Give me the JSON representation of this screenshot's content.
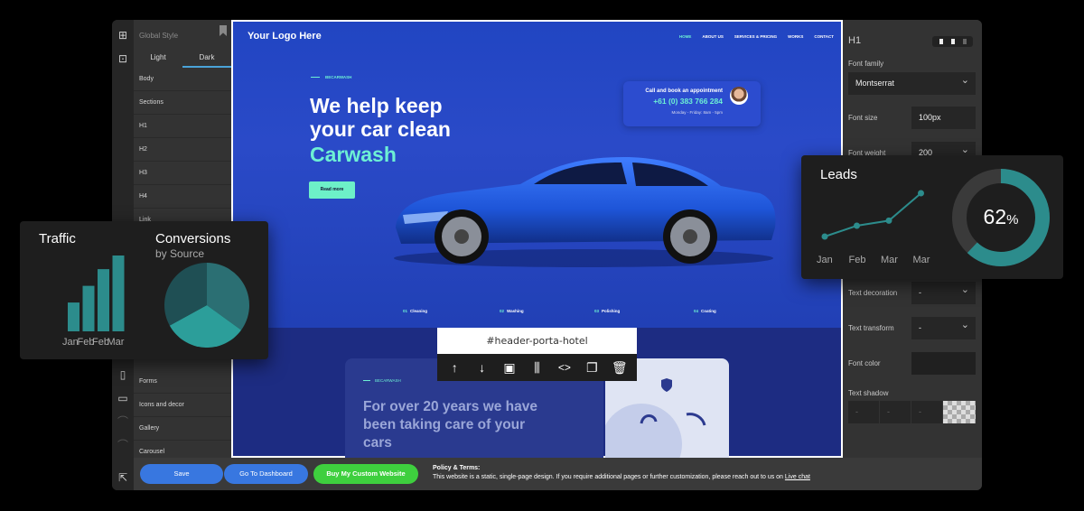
{
  "left_panel": {
    "title": "Global Style",
    "tabs": [
      "Light",
      "Dark"
    ],
    "items": [
      "Body",
      "Sections",
      "H1",
      "H2",
      "H3",
      "H4",
      "Link"
    ],
    "items_lower": [
      "Forms",
      "Icons and decor",
      "Gallery",
      "Carousel"
    ]
  },
  "site": {
    "logo": "Your Logo Here",
    "nav": [
      "HOME",
      "ABOUT US",
      "SERVICES & PRICING",
      "WORKS",
      "CONTACT"
    ],
    "tag": "BECARWASH",
    "headline_1": "We help keep",
    "headline_2": "your car clean",
    "headline_3": "Carwash",
    "read_more": "Read more",
    "call_title": "Call and book an appointment",
    "call_phone": "+61 (0) 383 766 284",
    "call_hours": "Monday - Friday: 8am - 5pm",
    "steps": [
      {
        "num": "01",
        "label": "Cleaning"
      },
      {
        "num": "02",
        "label": "Washing"
      },
      {
        "num": "03",
        "label": "Polishing"
      },
      {
        "num": "04",
        "label": "Coating"
      }
    ],
    "lower_tag": "BECARWASH",
    "lower_text": "For over 20 years we have been taking care of your cars"
  },
  "selector": {
    "id": "#header-porta-hotel",
    "tools": [
      "arrow-up-icon",
      "arrow-down-icon",
      "image-icon",
      "sliders-icon",
      "code-icon",
      "duplicate-icon",
      "trash-icon"
    ]
  },
  "right_panel": {
    "element": "H1",
    "font_family_label": "Font family",
    "font_family": "Montserrat",
    "font_size_label": "Font size",
    "font_size": "100px",
    "font_weight_label": "Font weight",
    "font_weight": "200",
    "text_decoration_label": "Text decoration",
    "text_decoration": "-",
    "text_transform_label": "Text transform",
    "text_transform": "-",
    "font_color_label": "Font color",
    "text_shadow_label": "Text shadow",
    "shadow_fields": [
      "-",
      "-",
      "-"
    ]
  },
  "bottom_bar": {
    "save": "Save",
    "dashboard": "Go To Dashboard",
    "buy": "Buy My Custom Website",
    "policy_title": "Policy & Terms:",
    "policy_text": "This website is a static, single-page design. If you require additional pages or further customization, please reach out to us on",
    "policy_link": "Live chat"
  },
  "traffic_widget": {
    "title": "Traffic",
    "conversions_title": "Conversions",
    "conversions_sub": "by Source",
    "chart_data": {
      "type": "bar",
      "categories": [
        "Jan",
        "Feb",
        "Feb",
        "Mar"
      ],
      "values": [
        38,
        60,
        82,
        100
      ],
      "ylim": [
        0,
        100
      ]
    },
    "pie": {
      "type": "pie",
      "values": [
        35,
        32,
        33
      ],
      "colors": [
        "#2b6f73",
        "#2c9e9a",
        "#1f4f54"
      ]
    }
  },
  "leads_widget": {
    "title": "Leads",
    "chart_data": {
      "type": "line",
      "categories": [
        "Jan",
        "Feb",
        "Mar",
        "Mar"
      ],
      "values": [
        20,
        35,
        42,
        80
      ],
      "ylim": [
        0,
        100
      ]
    },
    "donut": {
      "value": 62,
      "label": "62",
      "unit": "%"
    }
  },
  "colors": {
    "accent": "#6df0d4",
    "teal": "#2c8c8c",
    "blue_button": "#3877e0",
    "green_button": "#3ecf3e"
  }
}
